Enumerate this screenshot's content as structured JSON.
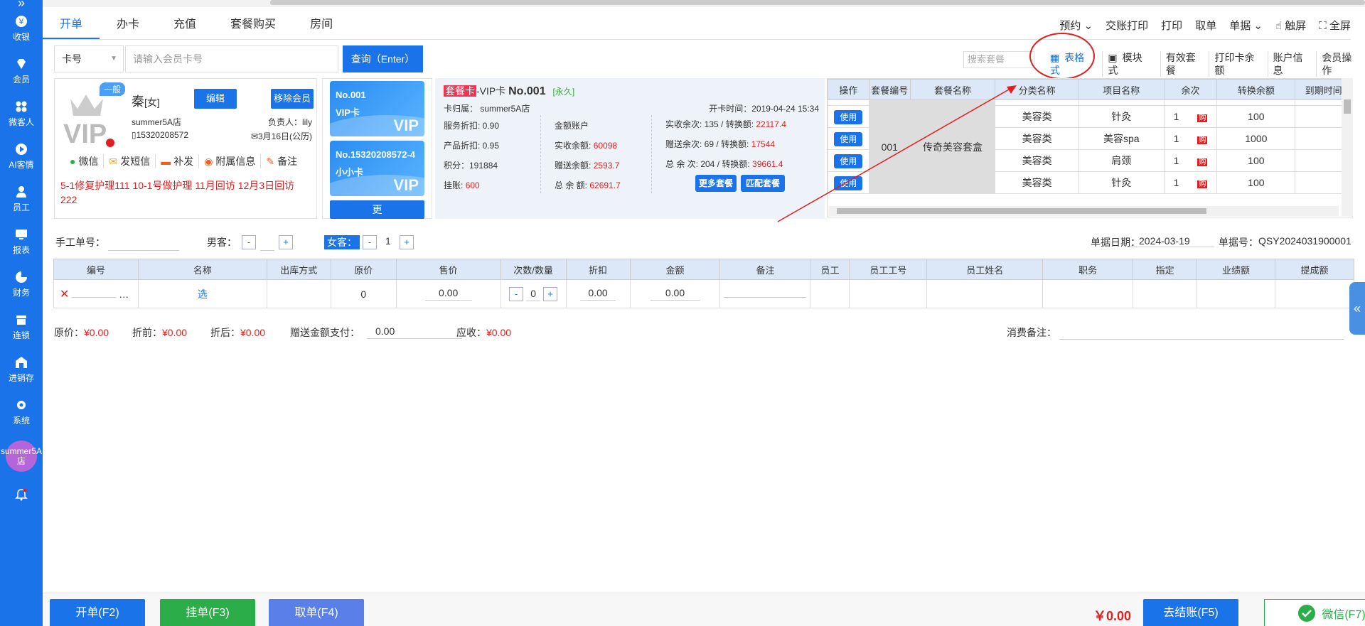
{
  "sidebar": {
    "items": [
      {
        "label": "收银",
        "icon": "yen-icon"
      },
      {
        "label": "会员",
        "icon": "diamond-icon"
      },
      {
        "label": "微客人",
        "icon": "grid-icon"
      },
      {
        "label": "AI客情",
        "icon": "play-icon"
      },
      {
        "label": "员工",
        "icon": "person-icon"
      },
      {
        "label": "报表",
        "icon": "monitor-icon"
      },
      {
        "label": "财务",
        "icon": "pie-icon"
      },
      {
        "label": "连锁",
        "icon": "shop-icon"
      },
      {
        "label": "进销存",
        "icon": "warehouse-icon"
      },
      {
        "label": "系统",
        "icon": "gear-icon"
      }
    ],
    "avatar_label": "summer5A店"
  },
  "tabs": [
    "开单",
    "办卡",
    "充值",
    "套餐购买",
    "房间"
  ],
  "top_actions": {
    "reserve": "预约",
    "shift_print": "交账打印",
    "print": "打印",
    "take_order": "取单",
    "documents": "单据",
    "touch": "触屏",
    "fullscreen": "全屏"
  },
  "search": {
    "card_type": "卡号",
    "placeholder": "请输入会员卡号",
    "query_button": "查询（Enter）"
  },
  "package_search_placeholder": "搜索套餐",
  "view_options": [
    "表格式",
    "模块式",
    "有效套餐",
    "打印卡余额",
    "账户信息",
    "会员操作"
  ],
  "member": {
    "level": "一般",
    "name": "秦",
    "gender": "[女]",
    "edit_button": "编辑",
    "remove_button": "移除会员",
    "store": "summer5A店",
    "manager": "负责人：lily",
    "phone": "15320208572",
    "birthday": "3月16日(公历)",
    "links": [
      "微信",
      "发短信",
      "补发",
      "附属信息",
      "备注"
    ],
    "note": "5-1修复护理111  10-1号做护理  11月回访  12月3日回访  222"
  },
  "cards": [
    {
      "no": "No.001",
      "name": "VIP卡",
      "badge": "VIP"
    },
    {
      "no": "No.15320208572-4",
      "name": "小小卡",
      "badge": "VIP"
    }
  ],
  "more_button": "更",
  "card_detail": {
    "tag": "套餐卡",
    "type": "-VIP卡",
    "no": "No.001",
    "validity": "[永久]",
    "belong": "卡归属：  summer5A店",
    "open_time": "开卡时间：2019-04-24 15:34",
    "service_discount": "服务折扣: 0.90",
    "product_discount": "产品折扣: 0.95",
    "points": "积分：191884",
    "credit_label": "挂账:",
    "credit_value": "600",
    "account_type": "金额账户",
    "real_balance_label": "实收余额:",
    "real_balance_value": "60098",
    "gift_balance_label": "赠送余额:",
    "gift_balance_value": "2593.7",
    "total_balance_label": "总 余 额:",
    "total_balance_value": "62691.7",
    "real_times_label": "实收余次: 135  / 转换额:",
    "real_times_value": "22117.4",
    "gift_times_label": "赠送余次: 69  / 转换额:",
    "gift_times_value": "17544",
    "total_times_label": "总 余 次: 204 / 转换额:",
    "total_times_value": "39661.4",
    "more_pkg_button": "更多套餐",
    "match_pkg_button": "匹配套餐"
  },
  "package_table": {
    "headers": [
      "操作",
      "套餐编号",
      "套餐名称",
      "分类名称",
      "项目名称",
      "余次",
      "转换余额",
      "到期时间"
    ],
    "pkg_no": "001",
    "pkg_name": "传奇美容套盒",
    "use_label": "使用",
    "buy_label": "购",
    "rows": [
      {
        "category": "美容类",
        "item": "针灸",
        "times": "1",
        "amount": "100"
      },
      {
        "category": "美容类",
        "item": "美容spa",
        "times": "1",
        "amount": "1000"
      },
      {
        "category": "美容类",
        "item": "肩颈",
        "times": "1",
        "amount": "100"
      },
      {
        "category": "美容类",
        "item": "针灸",
        "times": "1",
        "amount": "100"
      }
    ]
  },
  "order": {
    "manual_no_label": "手工单号：",
    "male_label": "男客：",
    "female_label": "女客：",
    "female_count": "1",
    "date_label": "单据日期：",
    "date_value": "2024-03-19",
    "order_no_label": "单据号：",
    "order_no_value": "QSY2024031900001"
  },
  "items_table": {
    "headers": [
      "编号",
      "名称",
      "出库方式",
      "原价",
      "售价",
      "次数/数量",
      "折扣",
      "金额",
      "备注",
      "员工",
      "员工工号",
      "员工姓名",
      "职务",
      "指定",
      "业绩额",
      "提成额"
    ],
    "row": {
      "select": "选",
      "orig_price": "0",
      "price": "0.00",
      "qty": "0",
      "discount": "0.00",
      "amount": "0.00"
    }
  },
  "summary": {
    "orig_label": "原价：",
    "orig_value": "¥0.00",
    "before_label": "折前：",
    "before_value": "¥0.00",
    "after_label": "折后：",
    "after_value": "¥0.00",
    "gift_pay_label": "赠送金额支付：",
    "gift_pay_value": "0.00",
    "receivable_label": "应收：",
    "receivable_value": "¥0.00",
    "remark_label": "消费备注："
  },
  "bottom": {
    "open_button": "开单(F2)",
    "hang_button": "挂单(F3)",
    "take_button": "取单(F4)",
    "total": "￥0.00",
    "checkout_button": "去结账(F5)",
    "wechat_button": "微信(F7)"
  },
  "colors": {
    "primary": "#1a73e8",
    "danger": "#e02020",
    "success": "#2bae4a"
  }
}
